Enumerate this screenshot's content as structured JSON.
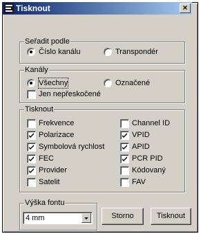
{
  "window": {
    "title": "Tisknout"
  },
  "sort_group": {
    "legend": "Seřadit podle",
    "options": [
      {
        "label": "Číslo kanálu",
        "selected": true
      },
      {
        "label": "Transpondér",
        "selected": false
      }
    ]
  },
  "channels_group": {
    "legend": "Kanály",
    "options": [
      {
        "label": "Všechny",
        "selected": true
      },
      {
        "label": "Označené",
        "selected": false
      }
    ],
    "skip_checkbox": {
      "label": "Jen nepřeskočené",
      "checked": false
    }
  },
  "print_group": {
    "legend": "Tisknout",
    "left": [
      {
        "label": "Frekvence",
        "checked": false
      },
      {
        "label": "Polarizace",
        "checked": true
      },
      {
        "label": "Symbolová rychlost",
        "checked": true
      },
      {
        "label": "FEC",
        "checked": true
      },
      {
        "label": "Provider",
        "checked": true
      },
      {
        "label": "Satelit",
        "checked": false
      }
    ],
    "right": [
      {
        "label": "Channel ID",
        "checked": false
      },
      {
        "label": "VPID",
        "checked": true
      },
      {
        "label": "APID",
        "checked": true
      },
      {
        "label": "PCR PID",
        "checked": true
      },
      {
        "label": "Kódovaný",
        "checked": false
      },
      {
        "label": "FAV",
        "checked": false
      }
    ]
  },
  "font_group": {
    "legend": "Výška fontu",
    "selected_value": "4 mm"
  },
  "buttons": {
    "cancel": "Storno",
    "print": "Tisknout"
  }
}
